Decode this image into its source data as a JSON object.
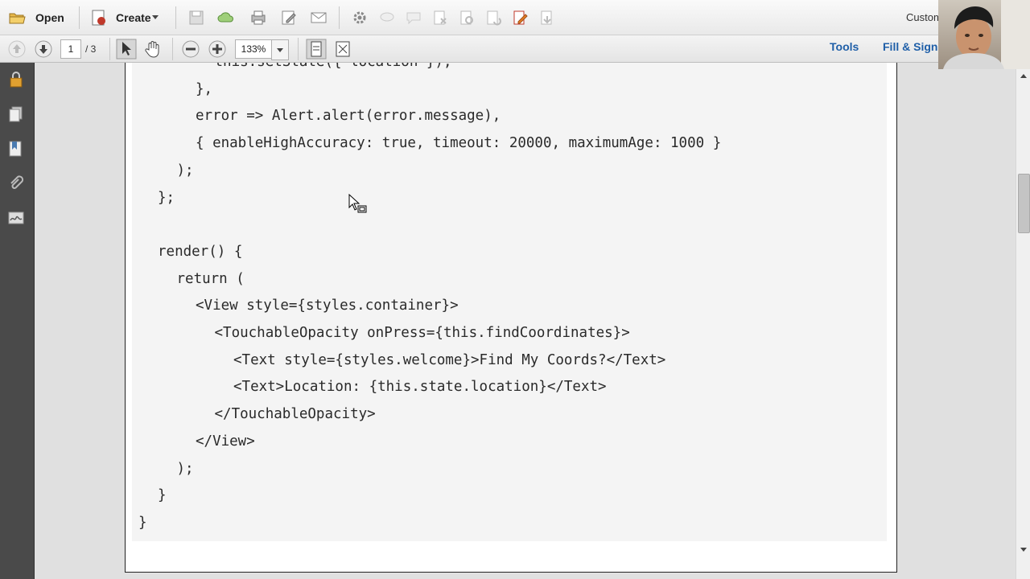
{
  "toolbar": {
    "open_label": "Open",
    "create_label": "Create",
    "customize_label": "Custom"
  },
  "navbar": {
    "page_current": "1",
    "page_total": "/ 3",
    "zoom": "133%",
    "tools_label": "Tools",
    "fill_sign_label": "Fill & Sign"
  },
  "code_lines": [
    "      this.setState({ location });",
    "    },",
    "    error => Alert.alert(error.message),",
    "    { enableHighAccuracy: true, timeout: 20000, maximumAge: 1000 }",
    "  );",
    "};",
    "",
    "render() {",
    "  return (",
    "    <View style={styles.container}>",
    "      <TouchableOpacity onPress={this.findCoordinates}>",
    "        <Text style={styles.welcome}>Find My Coords?</Text>",
    "        <Text>Location: {this.state.location}</Text>",
    "      </TouchableOpacity>",
    "    </View>",
    "  );",
    "}",
    "}"
  ],
  "colors": {
    "accent_link": "#1f5fa8",
    "nav_pane": "#4a4a4a"
  }
}
